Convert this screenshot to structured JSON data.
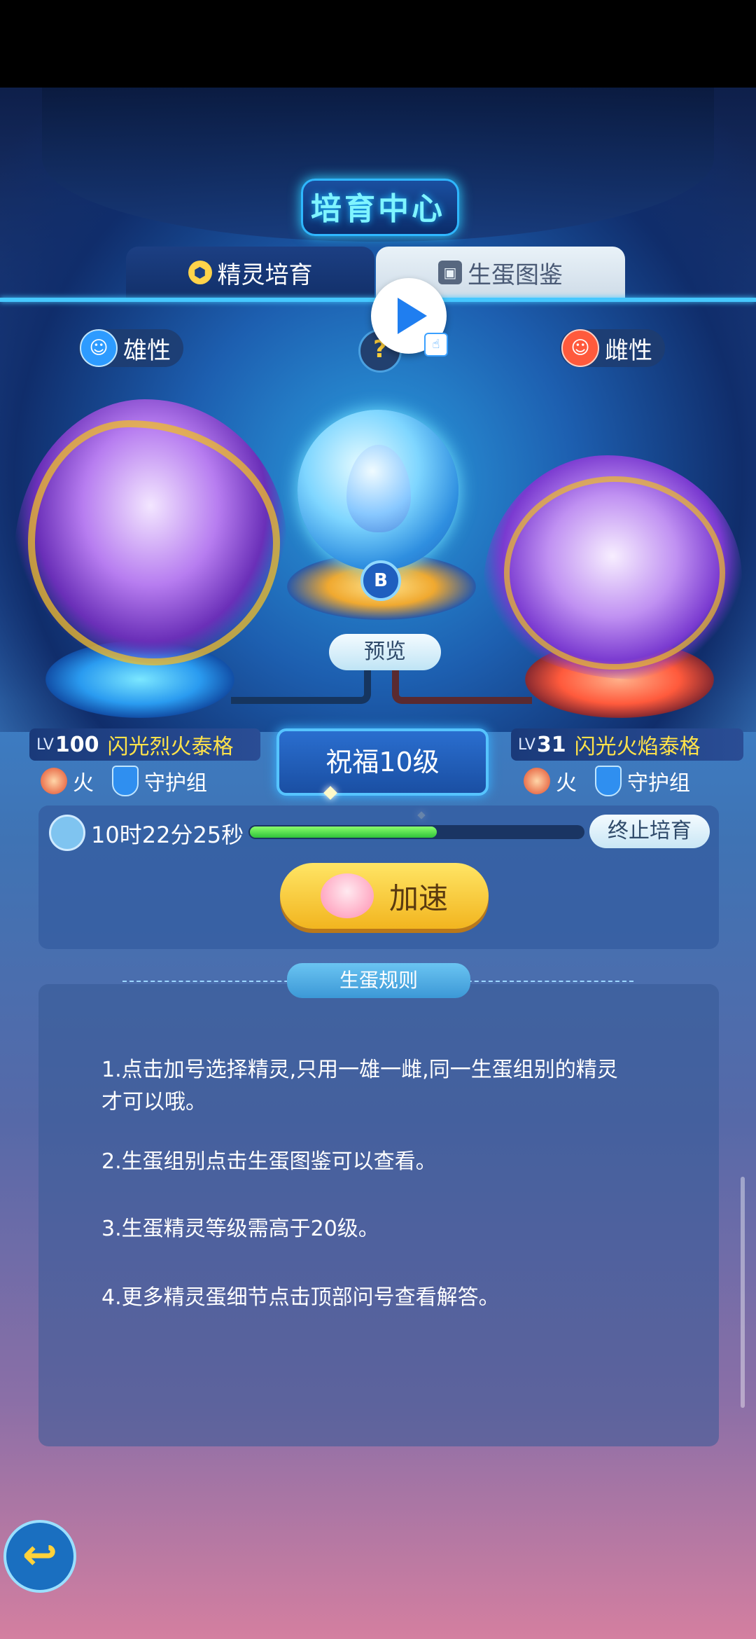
{
  "title": "培育中心",
  "tabs": [
    {
      "label": "精灵培育",
      "icon": "hexagon-icon",
      "active": true
    },
    {
      "label": "生蛋图鉴",
      "icon": "book-icon",
      "active": false
    }
  ],
  "help_icon": "?",
  "male": {
    "gender_label": "雄性",
    "level_prefix": "LV",
    "level": "100",
    "name": "闪光烈火泰格",
    "type": "火",
    "group": "守护组"
  },
  "female": {
    "gender_label": "雌性",
    "level_prefix": "LV",
    "level": "31",
    "name": "闪光火焰泰格",
    "type": "火",
    "group": "守护组"
  },
  "egg_badge": "B",
  "preview_label": "预览",
  "blessing_label": "祝福10级",
  "timer_text": "10时22分25秒",
  "progress_fraction": 0.56,
  "stop_label": "终止培育",
  "speed_label": "加速",
  "rules": {
    "heading": "生蛋规则",
    "items": [
      "1.点击加号选择精灵,只用一雄一雌,同一生蛋组别的精灵才可以哦。",
      "2.生蛋组别点击生蛋图鉴可以查看。",
      "3.生蛋精灵等级需高于20级。",
      "4.更多精灵蛋细节点击顶部问号查看解答。"
    ]
  },
  "colors": {
    "accent": "#46c8ff",
    "progress": "#2fc23a",
    "button_yellow": "#f2b51f",
    "name_yellow": "#ffe24a"
  }
}
